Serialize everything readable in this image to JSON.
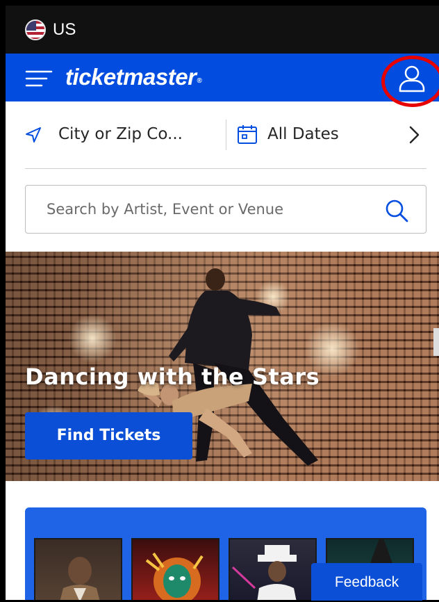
{
  "region": {
    "label": "US",
    "flag_icon": "us-flag-icon"
  },
  "header": {
    "logo_text": "ticketmaster",
    "logo_mark": "®",
    "brand_color": "#024ddf",
    "menu_icon": "hamburger-menu-icon",
    "account_icon": "user-account-icon",
    "highlight_color": "#e60000"
  },
  "filters": {
    "location_icon": "location-arrow-icon",
    "location_text": "City or Zip Co...",
    "date_icon": "calendar-icon",
    "date_text": "All Dates",
    "next_icon": "chevron-right-icon"
  },
  "search": {
    "placeholder": "Search by Artist, Event or Venue",
    "icon": "search-icon"
  },
  "hero": {
    "title": "Dancing with the Stars",
    "cta_label": "Find Tickets"
  },
  "promo": {
    "background_color": "#1f63e6",
    "tiles": [
      "hamilton-tile-image",
      "lion-king-tile-image",
      "michael-musical-tile-image",
      "wicked-tile-image"
    ]
  },
  "feedback": {
    "label": "Feedback"
  }
}
